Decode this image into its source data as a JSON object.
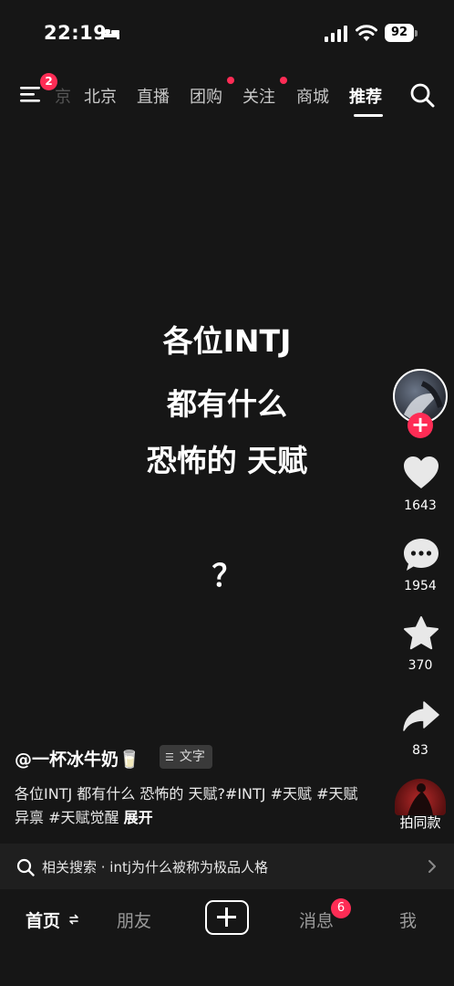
{
  "status_bar": {
    "time": "22:19",
    "battery": "92",
    "icons": [
      "bed-icon",
      "signal-icon",
      "wifi-icon",
      "battery-icon"
    ]
  },
  "top_nav": {
    "menu_badge": "2",
    "tabs": [
      {
        "label": "京"
      },
      {
        "label": "北京"
      },
      {
        "label": "直播"
      },
      {
        "label": "团购"
      },
      {
        "label": "关注"
      },
      {
        "label": "商城"
      },
      {
        "label": "推荐"
      }
    ]
  },
  "video": {
    "lines": [
      "各位INTJ",
      "都有什么",
      "恐怖的 天赋",
      "？"
    ]
  },
  "actions": {
    "likes": "1643",
    "comments": "1954",
    "favorites": "370",
    "shares": "83",
    "music_label": "拍同款"
  },
  "author": {
    "name": "@一杯冰牛奶🥛",
    "tag": "文字"
  },
  "description": {
    "text": "各位INTJ 都有什么 恐怖的 天赋?#INTJ #天赋 #天赋异禀 #天赋觉醒",
    "expand": "展开"
  },
  "related_search": {
    "text": "相关搜索 · intj为什么被称为极品人格"
  },
  "bottom_nav": {
    "items": [
      {
        "label": "首页"
      },
      {
        "label": "朋友"
      },
      {
        "label": "消息"
      },
      {
        "label": "我"
      }
    ],
    "message_badge": "6"
  },
  "colors": {
    "accent": "#fe2c55",
    "background": "#161616"
  }
}
